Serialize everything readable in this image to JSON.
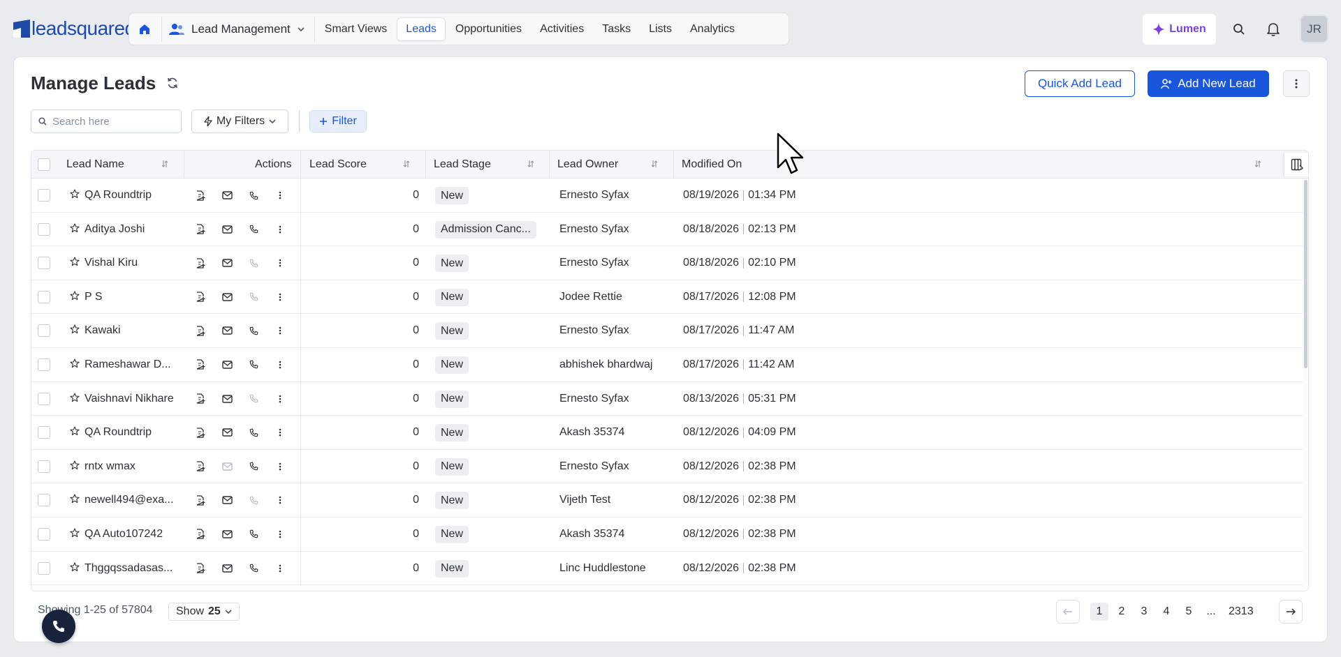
{
  "brand": {
    "logo_text": "leadsquared"
  },
  "nav": {
    "module": "Lead Management",
    "tabs": [
      {
        "label": "Smart Views",
        "active": false
      },
      {
        "label": "Leads",
        "active": true
      },
      {
        "label": "Opportunities",
        "active": false
      },
      {
        "label": "Activities",
        "active": false
      },
      {
        "label": "Tasks",
        "active": false
      },
      {
        "label": "Lists",
        "active": false
      },
      {
        "label": "Analytics",
        "active": false
      }
    ]
  },
  "topbar": {
    "lumen_label": "Lumen",
    "avatar_initials": "JR"
  },
  "page": {
    "title": "Manage Leads",
    "quick_add_label": "Quick Add Lead",
    "add_new_label": "Add New Lead"
  },
  "filters": {
    "search_placeholder": "Search here",
    "my_filters_label": "My Filters",
    "filter_label": "Filter"
  },
  "table": {
    "columns": {
      "lead_name": "Lead Name",
      "actions": "Actions",
      "lead_score": "Lead Score",
      "lead_stage": "Lead Stage",
      "lead_owner": "Lead Owner",
      "modified_on": "Modified On"
    },
    "rows": [
      {
        "name": "QA Roundtrip",
        "score": "0",
        "stage": "New",
        "owner": "Ernesto Syfax",
        "date": "08/19/2026",
        "time": "01:34 PM",
        "phone_enabled": true,
        "mail_enabled": true
      },
      {
        "name": "Aditya Joshi",
        "score": "0",
        "stage": "Admission Canc...",
        "owner": "Ernesto Syfax",
        "date": "08/18/2026",
        "time": "02:13 PM",
        "phone_enabled": true,
        "mail_enabled": true
      },
      {
        "name": "Vishal Kiru",
        "score": "0",
        "stage": "New",
        "owner": "Ernesto Syfax",
        "date": "08/18/2026",
        "time": "02:10 PM",
        "phone_enabled": false,
        "mail_enabled": true
      },
      {
        "name": "P S",
        "score": "0",
        "stage": "New",
        "owner": "Jodee Rettie",
        "date": "08/17/2026",
        "time": "12:08 PM",
        "phone_enabled": false,
        "mail_enabled": true
      },
      {
        "name": "Kawaki",
        "score": "0",
        "stage": "New",
        "owner": "Ernesto Syfax",
        "date": "08/17/2026",
        "time": "11:47 AM",
        "phone_enabled": true,
        "mail_enabled": true
      },
      {
        "name": "Rameshawar D...",
        "score": "0",
        "stage": "New",
        "owner": "abhishek bhardwaj",
        "date": "08/17/2026",
        "time": "11:42 AM",
        "phone_enabled": true,
        "mail_enabled": true
      },
      {
        "name": "Vaishnavi Nikhare",
        "score": "0",
        "stage": "New",
        "owner": "Ernesto Syfax",
        "date": "08/13/2026",
        "time": "05:31 PM",
        "phone_enabled": false,
        "mail_enabled": true
      },
      {
        "name": "QA Roundtrip",
        "score": "0",
        "stage": "New",
        "owner": "Akash 35374",
        "date": "08/12/2026",
        "time": "04:09 PM",
        "phone_enabled": true,
        "mail_enabled": true
      },
      {
        "name": "rntx wmax",
        "score": "0",
        "stage": "New",
        "owner": "Ernesto Syfax",
        "date": "08/12/2026",
        "time": "02:38 PM",
        "phone_enabled": true,
        "mail_enabled": false
      },
      {
        "name": "newell494@exa...",
        "score": "0",
        "stage": "New",
        "owner": "Vijeth Test",
        "date": "08/12/2026",
        "time": "02:38 PM",
        "phone_enabled": false,
        "mail_enabled": true
      },
      {
        "name": "QA Auto107242",
        "score": "0",
        "stage": "New",
        "owner": "Akash 35374",
        "date": "08/12/2026",
        "time": "02:38 PM",
        "phone_enabled": true,
        "mail_enabled": true
      },
      {
        "name": "Thggqssadasas...",
        "score": "0",
        "stage": "New",
        "owner": "Linc Huddlestone",
        "date": "08/12/2026",
        "time": "02:38 PM",
        "phone_enabled": true,
        "mail_enabled": true
      }
    ]
  },
  "footer": {
    "showing_text": "Showing 1-25 of 57804",
    "show_label": "Show",
    "show_value": "25",
    "pages": [
      "1",
      "2",
      "3",
      "4",
      "5",
      "...",
      "2313"
    ],
    "current_page": "1"
  },
  "colors": {
    "primary": "#1a56db",
    "lumen": "#7b3fe4",
    "fab": "#17233b"
  },
  "icons": [
    "home-icon",
    "people-icon",
    "chevron-down-icon",
    "sparkle-icon",
    "search-icon",
    "bell-icon",
    "refresh-icon",
    "user-plus-icon",
    "kebab-icon",
    "lightning-icon",
    "plus-icon",
    "sort-icon",
    "column-picker-icon",
    "star-icon",
    "note-add-icon",
    "mail-icon",
    "phone-icon",
    "arrow-left-icon",
    "arrow-right-icon"
  ]
}
